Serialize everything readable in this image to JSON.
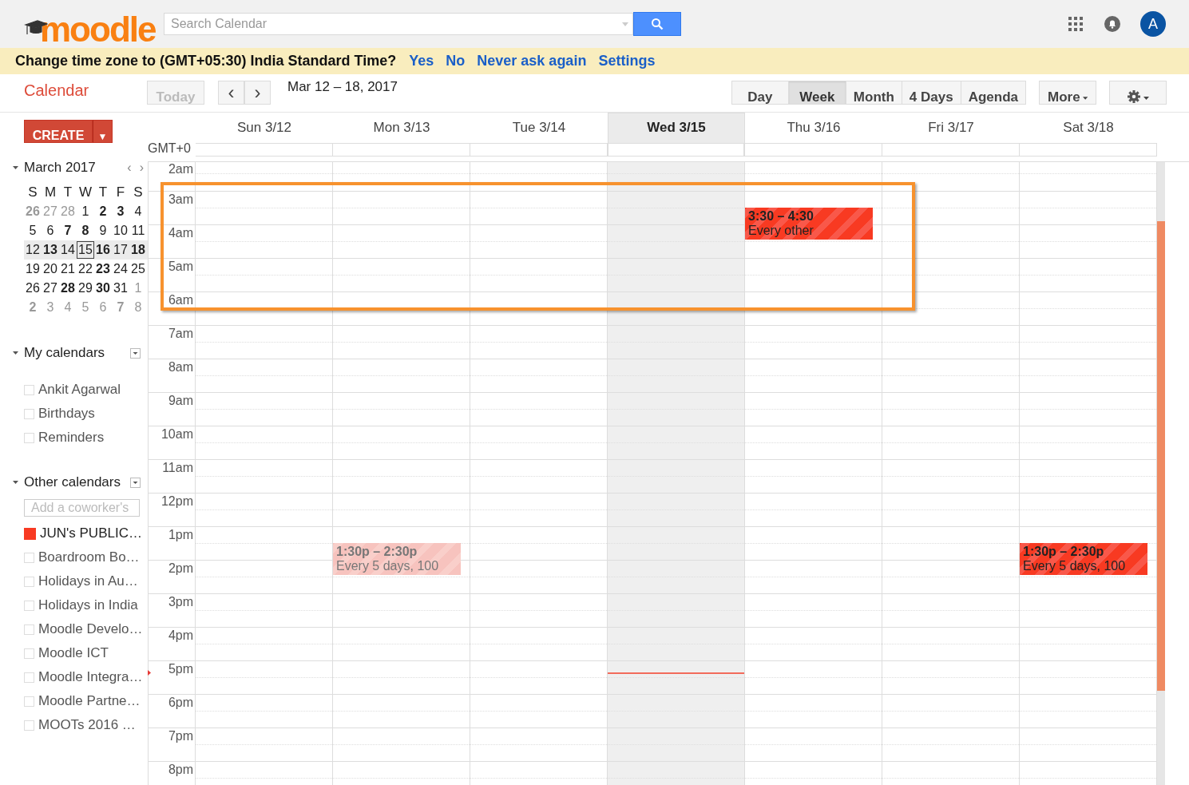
{
  "logo": {
    "text": "moodle"
  },
  "search": {
    "placeholder": "Search Calendar"
  },
  "account": {
    "initial": "A"
  },
  "banner": {
    "question": "Change time zone to (GMT+05:30) India Standard Time?",
    "links": [
      "Yes",
      "No",
      "Never ask again",
      "Settings"
    ]
  },
  "toolbar": {
    "title": "Calendar",
    "today": "Today",
    "prev": "‹",
    "next": "›",
    "range": "Mar 12 – 18, 2017",
    "views": [
      {
        "label": "Day",
        "selected": false
      },
      {
        "label": "Week",
        "selected": true
      },
      {
        "label": "Month",
        "selected": false
      },
      {
        "label": "4 Days",
        "selected": false
      },
      {
        "label": "Agenda",
        "selected": false
      }
    ],
    "more": "More"
  },
  "create": {
    "label": "CREATE",
    "caret": "▼"
  },
  "mini_calendar": {
    "title": "March 2017",
    "prev": "‹",
    "next": "›",
    "weekdays": [
      "S",
      "M",
      "T",
      "W",
      "T",
      "F",
      "S"
    ],
    "weeks": [
      {
        "selected": false,
        "days": [
          {
            "d": "26",
            "bold": true,
            "muted": true,
            "today": false
          },
          {
            "d": "27",
            "bold": false,
            "muted": true,
            "today": false
          },
          {
            "d": "28",
            "bold": false,
            "muted": true,
            "today": false
          },
          {
            "d": "1",
            "bold": false,
            "muted": false,
            "today": false
          },
          {
            "d": "2",
            "bold": true,
            "muted": false,
            "today": false
          },
          {
            "d": "3",
            "bold": true,
            "muted": false,
            "today": false
          },
          {
            "d": "4",
            "bold": false,
            "muted": false,
            "today": false
          }
        ]
      },
      {
        "selected": false,
        "days": [
          {
            "d": "5",
            "bold": false,
            "muted": false,
            "today": false
          },
          {
            "d": "6",
            "bold": false,
            "muted": false,
            "today": false
          },
          {
            "d": "7",
            "bold": true,
            "muted": false,
            "today": false
          },
          {
            "d": "8",
            "bold": true,
            "muted": false,
            "today": false
          },
          {
            "d": "9",
            "bold": false,
            "muted": false,
            "today": false
          },
          {
            "d": "10",
            "bold": false,
            "muted": false,
            "today": false
          },
          {
            "d": "11",
            "bold": false,
            "muted": false,
            "today": false
          }
        ]
      },
      {
        "selected": true,
        "days": [
          {
            "d": "12",
            "bold": false,
            "muted": false,
            "today": false
          },
          {
            "d": "13",
            "bold": true,
            "muted": false,
            "today": false
          },
          {
            "d": "14",
            "bold": false,
            "muted": false,
            "today": false
          },
          {
            "d": "15",
            "bold": false,
            "muted": false,
            "today": true
          },
          {
            "d": "16",
            "bold": true,
            "muted": false,
            "today": false
          },
          {
            "d": "17",
            "bold": false,
            "muted": false,
            "today": false
          },
          {
            "d": "18",
            "bold": true,
            "muted": false,
            "today": false
          }
        ]
      },
      {
        "selected": false,
        "days": [
          {
            "d": "19",
            "bold": false,
            "muted": false,
            "today": false
          },
          {
            "d": "20",
            "bold": false,
            "muted": false,
            "today": false
          },
          {
            "d": "21",
            "bold": false,
            "muted": false,
            "today": false
          },
          {
            "d": "22",
            "bold": false,
            "muted": false,
            "today": false
          },
          {
            "d": "23",
            "bold": true,
            "muted": false,
            "today": false
          },
          {
            "d": "24",
            "bold": false,
            "muted": false,
            "today": false
          },
          {
            "d": "25",
            "bold": false,
            "muted": false,
            "today": false
          }
        ]
      },
      {
        "selected": false,
        "days": [
          {
            "d": "26",
            "bold": false,
            "muted": false,
            "today": false
          },
          {
            "d": "27",
            "bold": false,
            "muted": false,
            "today": false
          },
          {
            "d": "28",
            "bold": true,
            "muted": false,
            "today": false
          },
          {
            "d": "29",
            "bold": false,
            "muted": false,
            "today": false
          },
          {
            "d": "30",
            "bold": true,
            "muted": false,
            "today": false
          },
          {
            "d": "31",
            "bold": false,
            "muted": false,
            "today": false
          },
          {
            "d": "1",
            "bold": false,
            "muted": true,
            "today": false
          }
        ]
      },
      {
        "selected": false,
        "days": [
          {
            "d": "2",
            "bold": true,
            "muted": true,
            "today": false
          },
          {
            "d": "3",
            "bold": false,
            "muted": true,
            "today": false
          },
          {
            "d": "4",
            "bold": false,
            "muted": true,
            "today": false
          },
          {
            "d": "5",
            "bold": false,
            "muted": true,
            "today": false
          },
          {
            "d": "6",
            "bold": false,
            "muted": true,
            "today": false
          },
          {
            "d": "7",
            "bold": true,
            "muted": true,
            "today": false
          },
          {
            "d": "8",
            "bold": false,
            "muted": true,
            "today": false
          }
        ]
      }
    ]
  },
  "my_calendars": {
    "title": "My calendars",
    "expanded": true,
    "items": [
      {
        "label": "Ankit Agarwal",
        "checked": false
      },
      {
        "label": "Birthdays",
        "checked": false
      },
      {
        "label": "Reminders",
        "checked": false
      }
    ]
  },
  "other_calendars": {
    "title": "Other calendars",
    "expanded": true,
    "add_placeholder": "Add a coworker's",
    "items": [
      {
        "label": "JUN's PUBLIC…",
        "checked": true,
        "color": "#f83a22"
      },
      {
        "label": "Boardroom Bo…",
        "checked": false
      },
      {
        "label": "Holidays in Au…",
        "checked": false
      },
      {
        "label": "Holidays in India",
        "checked": false
      },
      {
        "label": "Moodle Develo…",
        "checked": false
      },
      {
        "label": "Moodle ICT",
        "checked": false
      },
      {
        "label": "Moodle Integra…",
        "checked": false
      },
      {
        "label": "Moodle Partne…",
        "checked": false
      },
      {
        "label": "MOOTs 2016 …",
        "checked": false
      }
    ]
  },
  "week": {
    "timezone": "GMT+0",
    "hours": [
      "2am",
      "3am",
      "4am",
      "5am",
      "6am",
      "7am",
      "8am",
      "9am",
      "10am",
      "11am",
      "12pm",
      "1pm",
      "2pm",
      "3pm",
      "4pm",
      "5pm",
      "6pm",
      "7pm",
      "8pm"
    ],
    "days": [
      {
        "label": "Sun 3/12",
        "selected": false
      },
      {
        "label": "Mon 3/13",
        "selected": false,
        "events": [
          {
            "time": "1:30p – 2:30p",
            "title": "Every 5 days, 100",
            "dimmed": true
          }
        ]
      },
      {
        "label": "Tue 3/14",
        "selected": false
      },
      {
        "label": "Wed 3/15",
        "selected": true
      },
      {
        "label": "Thu 3/16",
        "selected": false,
        "events": [
          {
            "time": "3:30 – 4:30",
            "title": "Every other",
            "dimmed": false
          }
        ]
      },
      {
        "label": "Fri 3/17",
        "selected": false
      },
      {
        "label": "Sat 3/18",
        "selected": false,
        "events": [
          {
            "time": "1:30p – 2:30p",
            "title": "Every 5 days, 100",
            "dimmed": false
          }
        ]
      }
    ]
  }
}
